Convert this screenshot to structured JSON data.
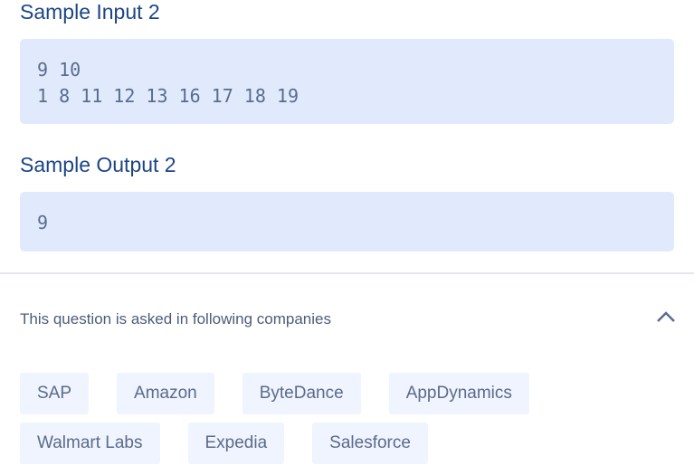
{
  "sample_input": {
    "title": "Sample Input 2",
    "lines": "9 10\n1 8 11 12 13 16 17 18 19"
  },
  "sample_output": {
    "title": "Sample Output 2",
    "lines": "9"
  },
  "companies": {
    "label": "This question is asked in following companies",
    "toggle_icon": "chevron-up-icon",
    "items": [
      "SAP",
      "Amazon",
      "ByteDance",
      "AppDynamics",
      "Walmart Labs",
      "Expedia",
      "Salesforce"
    ]
  }
}
